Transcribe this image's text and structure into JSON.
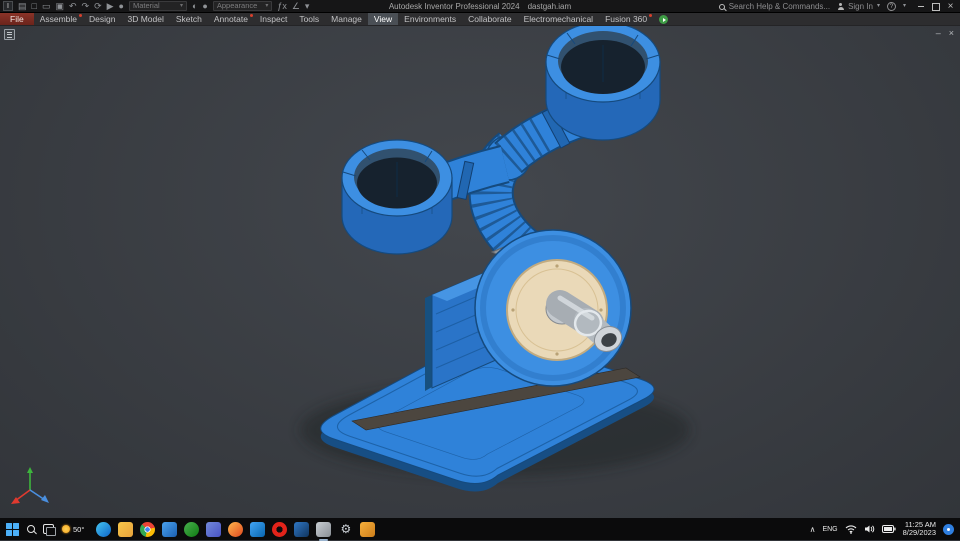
{
  "titlebar": {
    "app_title": "Autodesk Inventor Professional 2024",
    "doc_title": "dastgah.iam",
    "search_label": "Search Help & Commands...",
    "sign_in_label": "Sign In",
    "qat": [
      {
        "t": "i",
        "n": "app-menu-icon",
        "g": "▤"
      },
      {
        "t": "i",
        "n": "new-file-icon",
        "g": "□"
      },
      {
        "t": "i",
        "n": "open-icon",
        "g": "▭"
      },
      {
        "t": "i",
        "n": "save-icon",
        "g": "▣"
      },
      {
        "t": "i",
        "n": "undo-icon",
        "g": "↶"
      },
      {
        "t": "i",
        "n": "redo-icon",
        "g": "↷"
      },
      {
        "t": "i",
        "n": "update-icon",
        "g": "⟳"
      },
      {
        "t": "i",
        "n": "select-icon",
        "g": "▶"
      },
      {
        "t": "i",
        "n": "material-sphere-icon",
        "g": "●"
      },
      {
        "t": "c",
        "n": "material-dropdown",
        "label": "Material"
      },
      {
        "t": "i",
        "n": "adjust-icon",
        "g": "◐"
      },
      {
        "t": "i",
        "n": "appearance-sphere-icon",
        "g": "●"
      },
      {
        "t": "c",
        "n": "appearance-dropdown",
        "label": "Appearance"
      },
      {
        "t": "i",
        "n": "parameters-icon",
        "g": "ƒx"
      },
      {
        "t": "i",
        "n": "measure-icon",
        "g": "∠"
      },
      {
        "t": "i",
        "n": "dropdown-caret-icon",
        "g": "▾"
      }
    ]
  },
  "ribbon": {
    "active_tab": "View",
    "tabs": [
      {
        "label": "File",
        "style": "file"
      },
      {
        "label": "Assemble",
        "badge": true
      },
      {
        "label": "Design"
      },
      {
        "label": "3D Model"
      },
      {
        "label": "Sketch"
      },
      {
        "label": "Annotate",
        "badge": true
      },
      {
        "label": "Inspect"
      },
      {
        "label": "Tools"
      },
      {
        "label": "Manage"
      },
      {
        "label": "View",
        "active": true
      },
      {
        "label": "Environments"
      },
      {
        "label": "Collaborate"
      },
      {
        "label": "Electromechanical"
      },
      {
        "label": "Fusion 360",
        "badge": true
      }
    ]
  },
  "viewport": {
    "model_description": "Blue blower / fan duct assembly (dastgah.iam) on rounded base plate, two ring outlets, tan impeller face with metal elbow nozzle",
    "colors": {
      "body": "#2f82d9",
      "body_dark": "#2468b8",
      "body_light": "#3d8fe2",
      "edge": "#154a7e",
      "face": "#ead9b8",
      "metal": "#a7adb3",
      "hole": "#16222e",
      "bg1": "#43474d",
      "bg2": "#32353a"
    }
  },
  "taskbar": {
    "weather_temp": "50°",
    "apps": [
      {
        "name": "edge",
        "shape": "circle",
        "c1": "#45c5f1",
        "c2": "#0d64c8"
      },
      {
        "name": "file-explorer",
        "shape": "square",
        "c1": "#f7c64a",
        "c2": "#e8a23b"
      },
      {
        "name": "chrome",
        "shape": "circle",
        "chrome": true
      },
      {
        "name": "photos",
        "shape": "square",
        "c1": "#4aa3f0",
        "c2": "#1b5fb0"
      },
      {
        "name": "xbox",
        "shape": "circle",
        "c1": "#49b04e",
        "c2": "#0e7a12"
      },
      {
        "name": "discord",
        "shape": "square",
        "c1": "#7289da",
        "c2": "#4853c4"
      },
      {
        "name": "firefox",
        "shape": "circle",
        "c1": "#ffb84d",
        "c2": "#e0491f"
      },
      {
        "name": "vscode",
        "shape": "square",
        "c1": "#42a5f5",
        "c2": "#0866b0"
      },
      {
        "name": "opera",
        "shape": "circle",
        "ring": true,
        "c1": "#e2231a",
        "c2": "#0b0b0c"
      },
      {
        "name": "photoshop",
        "shape": "square",
        "c1": "#2f77c4",
        "c2": "#10345e"
      },
      {
        "name": "autodesk-inventor",
        "shape": "square",
        "c1": "#c8cdd2",
        "c2": "#8a9096",
        "running": true
      },
      {
        "name": "settings",
        "shape": "square",
        "glyph": "⚙"
      },
      {
        "name": "notepad",
        "shape": "square",
        "c1": "#f6b03c",
        "c2": "#cd7d1a"
      }
    ],
    "tray": {
      "lang": "ENG",
      "time": "11:25 AM",
      "date": "8/29/2023"
    }
  }
}
